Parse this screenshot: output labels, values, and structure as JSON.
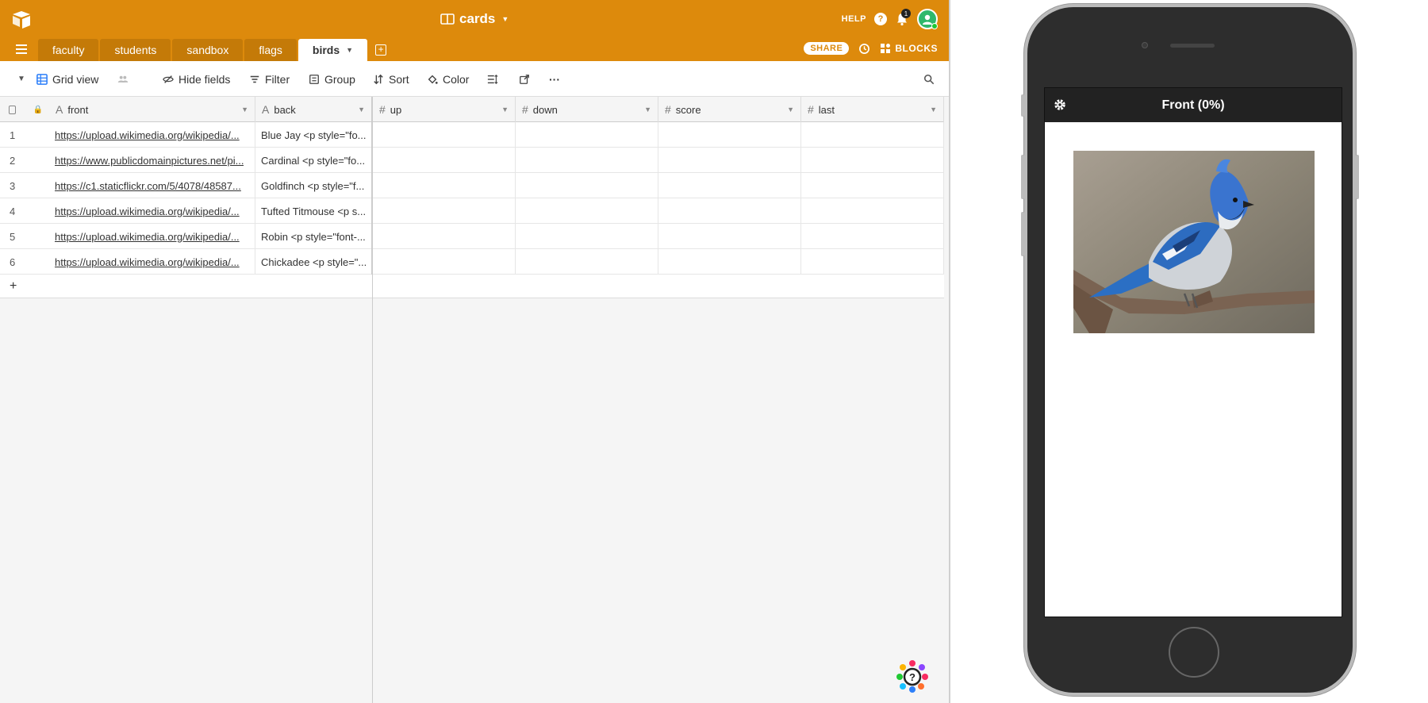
{
  "app": {
    "base_title": "cards",
    "help_label": "HELP",
    "notification_count": "1",
    "tabs": [
      {
        "label": "faculty"
      },
      {
        "label": "students"
      },
      {
        "label": "sandbox"
      },
      {
        "label": "flags"
      },
      {
        "label": "birds"
      }
    ],
    "share_label": "SHARE",
    "blocks_label": "BLOCKS",
    "brand_color": "#dd8a0c"
  },
  "toolbar": {
    "view_label": "Grid view",
    "hide_fields": "Hide fields",
    "filter": "Filter",
    "group": "Group",
    "sort": "Sort",
    "color": "Color",
    "more": "···"
  },
  "grid": {
    "columns": {
      "front": "front",
      "back": "back",
      "up": "up",
      "down": "down",
      "score": "score",
      "last": "last"
    },
    "add_row": "+",
    "rows": [
      {
        "n": "1",
        "front": "https://upload.wikimedia.org/wikipedia/...",
        "back": "Blue Jay <p style=\"fo..."
      },
      {
        "n": "2",
        "front": "https://www.publicdomainpictures.net/pi...",
        "back": "Cardinal <p style=\"fo..."
      },
      {
        "n": "3",
        "front": "https://c1.staticflickr.com/5/4078/48587...",
        "back": "Goldfinch <p style=\"f..."
      },
      {
        "n": "4",
        "front": "https://upload.wikimedia.org/wikipedia/...",
        "back": "Tufted Titmouse <p s..."
      },
      {
        "n": "5",
        "front": "https://upload.wikimedia.org/wikipedia/...",
        "back": "Robin <p style=\"font-..."
      },
      {
        "n": "6",
        "front": "https://upload.wikimedia.org/wikipedia/...",
        "back": "Chickadee <p style=\"..."
      }
    ]
  },
  "preview": {
    "header": "Front (0%)"
  }
}
